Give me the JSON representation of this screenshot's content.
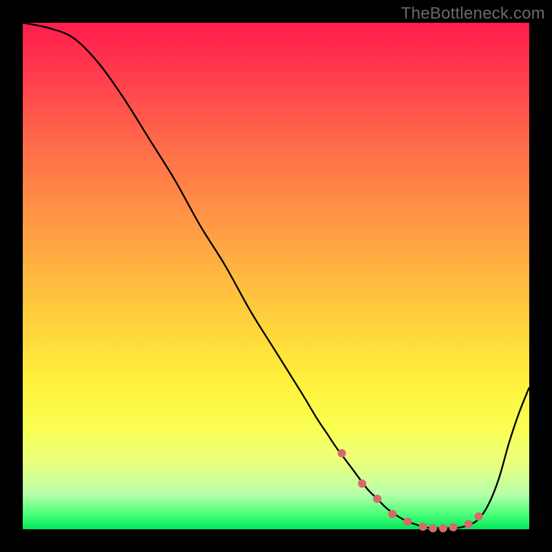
{
  "watermark": "TheBottleneck.com",
  "colors": {
    "frame": "#000000",
    "gradient_top": "#ff1d4d",
    "gradient_bottom": "#00e85a",
    "curve_stroke": "#000000",
    "marker_fill": "#d66a6a"
  },
  "chart_data": {
    "type": "line",
    "title": "",
    "xlabel": "",
    "ylabel": "",
    "xlim": [
      0,
      100
    ],
    "ylim": [
      0,
      100
    ],
    "grid": false,
    "legend": false,
    "series": [
      {
        "name": "bottleneck-curve",
        "x": [
          0,
          5,
          10,
          15,
          20,
          25,
          30,
          35,
          40,
          45,
          50,
          55,
          58,
          60,
          62,
          65,
          68,
          70,
          72,
          75,
          78,
          80,
          82,
          84,
          86,
          88,
          90,
          92,
          94,
          96,
          98,
          100
        ],
        "y": [
          100,
          99,
          97,
          92,
          85,
          77,
          69,
          60,
          52,
          43,
          35,
          27,
          22,
          19,
          16,
          12,
          8,
          6,
          4,
          2,
          0.8,
          0.3,
          0.2,
          0.2,
          0.3,
          0.8,
          2,
          5,
          10,
          17,
          23,
          28
        ]
      }
    ],
    "markers": {
      "name": "optimal-range",
      "x": [
        63,
        67,
        70,
        73,
        76,
        79,
        81,
        83,
        85,
        88,
        90
      ],
      "y": [
        15,
        9,
        6,
        3,
        1.5,
        0.5,
        0.2,
        0.2,
        0.4,
        1,
        2.5
      ]
    }
  }
}
